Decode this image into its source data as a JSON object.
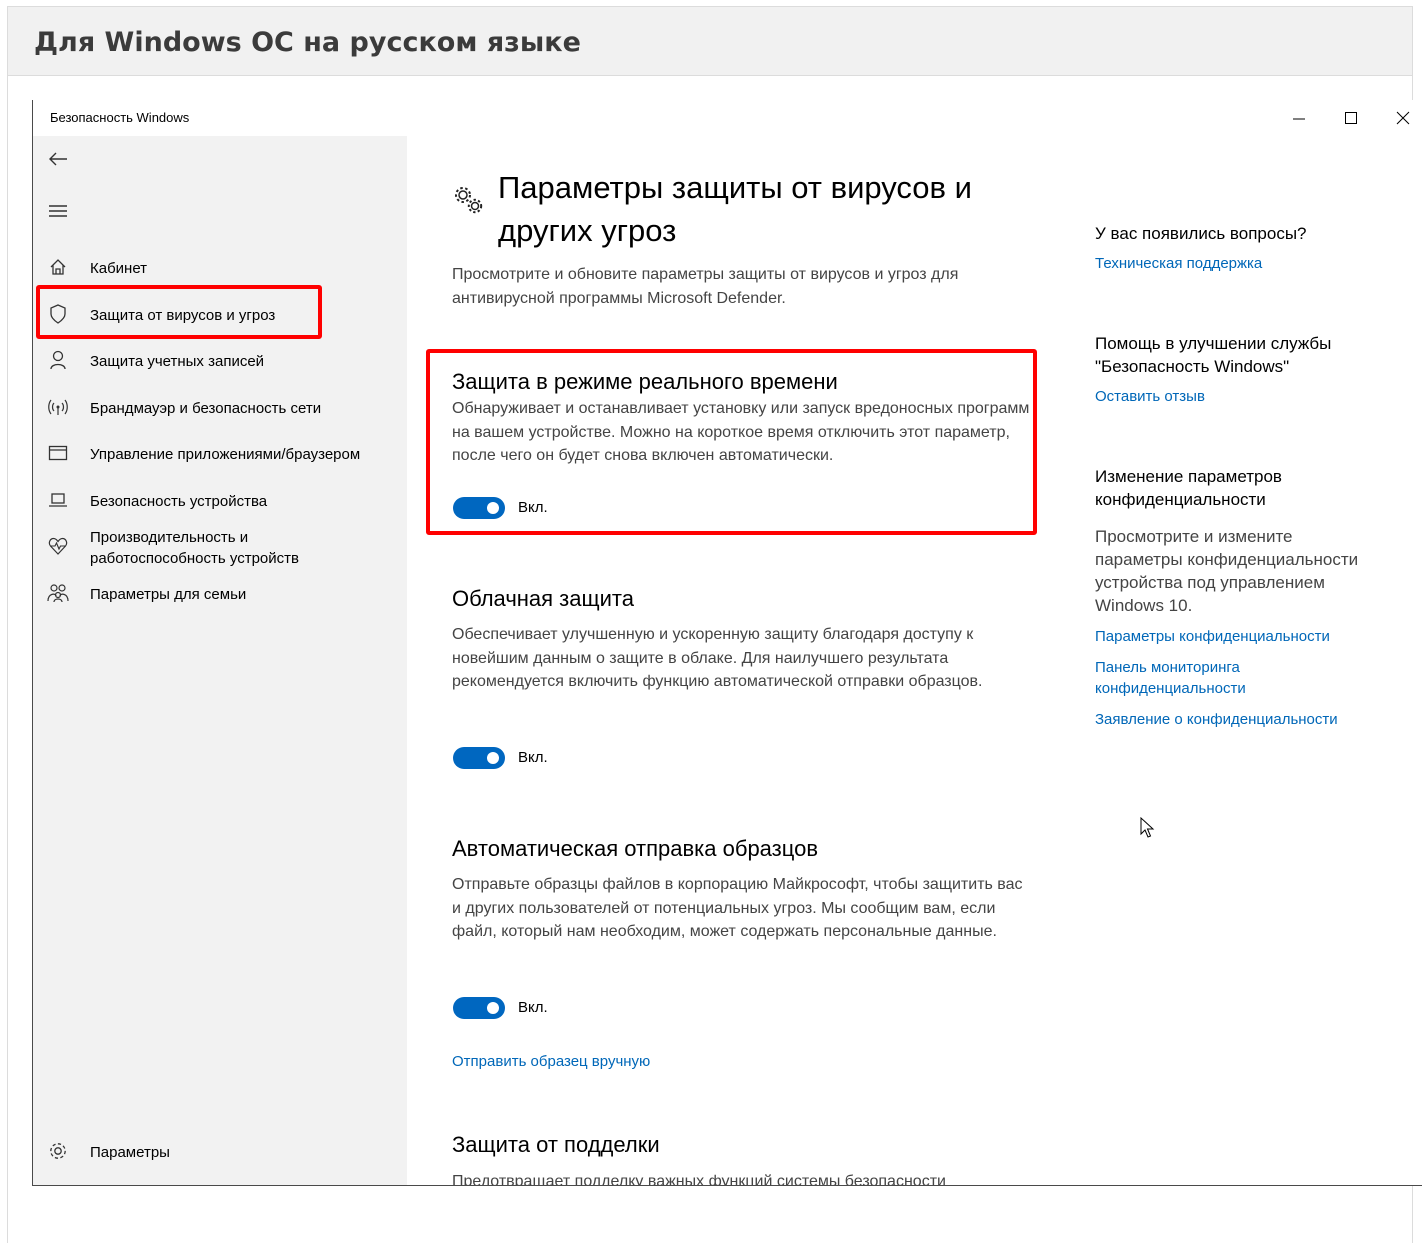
{
  "doc": {
    "heading": "Для Windows ОС на русском языке"
  },
  "window": {
    "title": "Безопасность Windows",
    "controls": {
      "minimize": "—",
      "maximize": "☐",
      "close": "✕"
    }
  },
  "sidebar": {
    "items": [
      {
        "label": "Кабинет",
        "icon": "home-icon"
      },
      {
        "label": "Защита от вирусов и угроз",
        "icon": "shield-icon",
        "highlighted": true
      },
      {
        "label": "Защита учетных записей",
        "icon": "person-icon"
      },
      {
        "label": "Брандмауэр и безопасность сети",
        "icon": "wifi-signal-icon"
      },
      {
        "label": "Управление приложениями/браузером",
        "icon": "browser-window-icon"
      },
      {
        "label": "Безопасность устройства",
        "icon": "laptop-icon"
      },
      {
        "label": "Производительность и работоспособность устройств",
        "icon": "heart-pulse-icon"
      },
      {
        "label": "Параметры для семьи",
        "icon": "family-icon"
      }
    ],
    "settings_label": "Параметры"
  },
  "main": {
    "title": "Параметры защиты от вирусов и других угроз",
    "description": "Просмотрите и обновите параметры защиты от вирусов и угроз для антивирусной программы Microsoft Defender.",
    "sections": [
      {
        "title": "Защита в режиме реального времени",
        "text": "Обнаруживает и останавливает установку или запуск вредоносных программ на вашем устройстве. Можно на короткое время отключить этот параметр, после чего он будет снова включен автоматически.",
        "toggle_label": "Вкл.",
        "toggle_on": true
      },
      {
        "title": "Облачная защита",
        "text": "Обеспечивает улучшенную и ускоренную защиту благодаря доступу к новейшим данным о защите в облаке. Для наилучшего результата рекомендуется включить функцию автоматической отправки образцов.",
        "toggle_label": "Вкл.",
        "toggle_on": true
      },
      {
        "title": "Автоматическая отправка образцов",
        "text": "Отправьте образцы файлов в корпорацию Майкрософт, чтобы защитить вас и других пользователей от потенциальных угроз. Мы сообщим вам, если файл, который нам необходим, может содержать персональные данные.",
        "toggle_label": "Вкл.",
        "toggle_on": true,
        "link": "Отправить образец вручную"
      },
      {
        "title": "Защита от подделки",
        "text": "Предотвращает подделку важных функций системы безопасности"
      }
    ]
  },
  "aside": {
    "questions": {
      "heading": "У вас появились вопросы?",
      "link": "Техническая поддержка"
    },
    "improve": {
      "heading": "Помощь в улучшении службы \"Безопасность Windows\"",
      "link": "Оставить отзыв"
    },
    "privacy": {
      "heading": "Изменение параметров конфиденциальности",
      "text": "Просмотрите и измените параметры конфиденциальности устройства под управлением Windows 10.",
      "links": [
        "Параметры конфиденциальности",
        "Панель мониторинга конфиденциальности",
        "Заявление о конфиденциальности"
      ]
    }
  },
  "colors": {
    "accent": "#0067c0",
    "link": "#0067b8",
    "highlight": "#ff0000",
    "sidebar_bg": "#f2f2f2"
  }
}
